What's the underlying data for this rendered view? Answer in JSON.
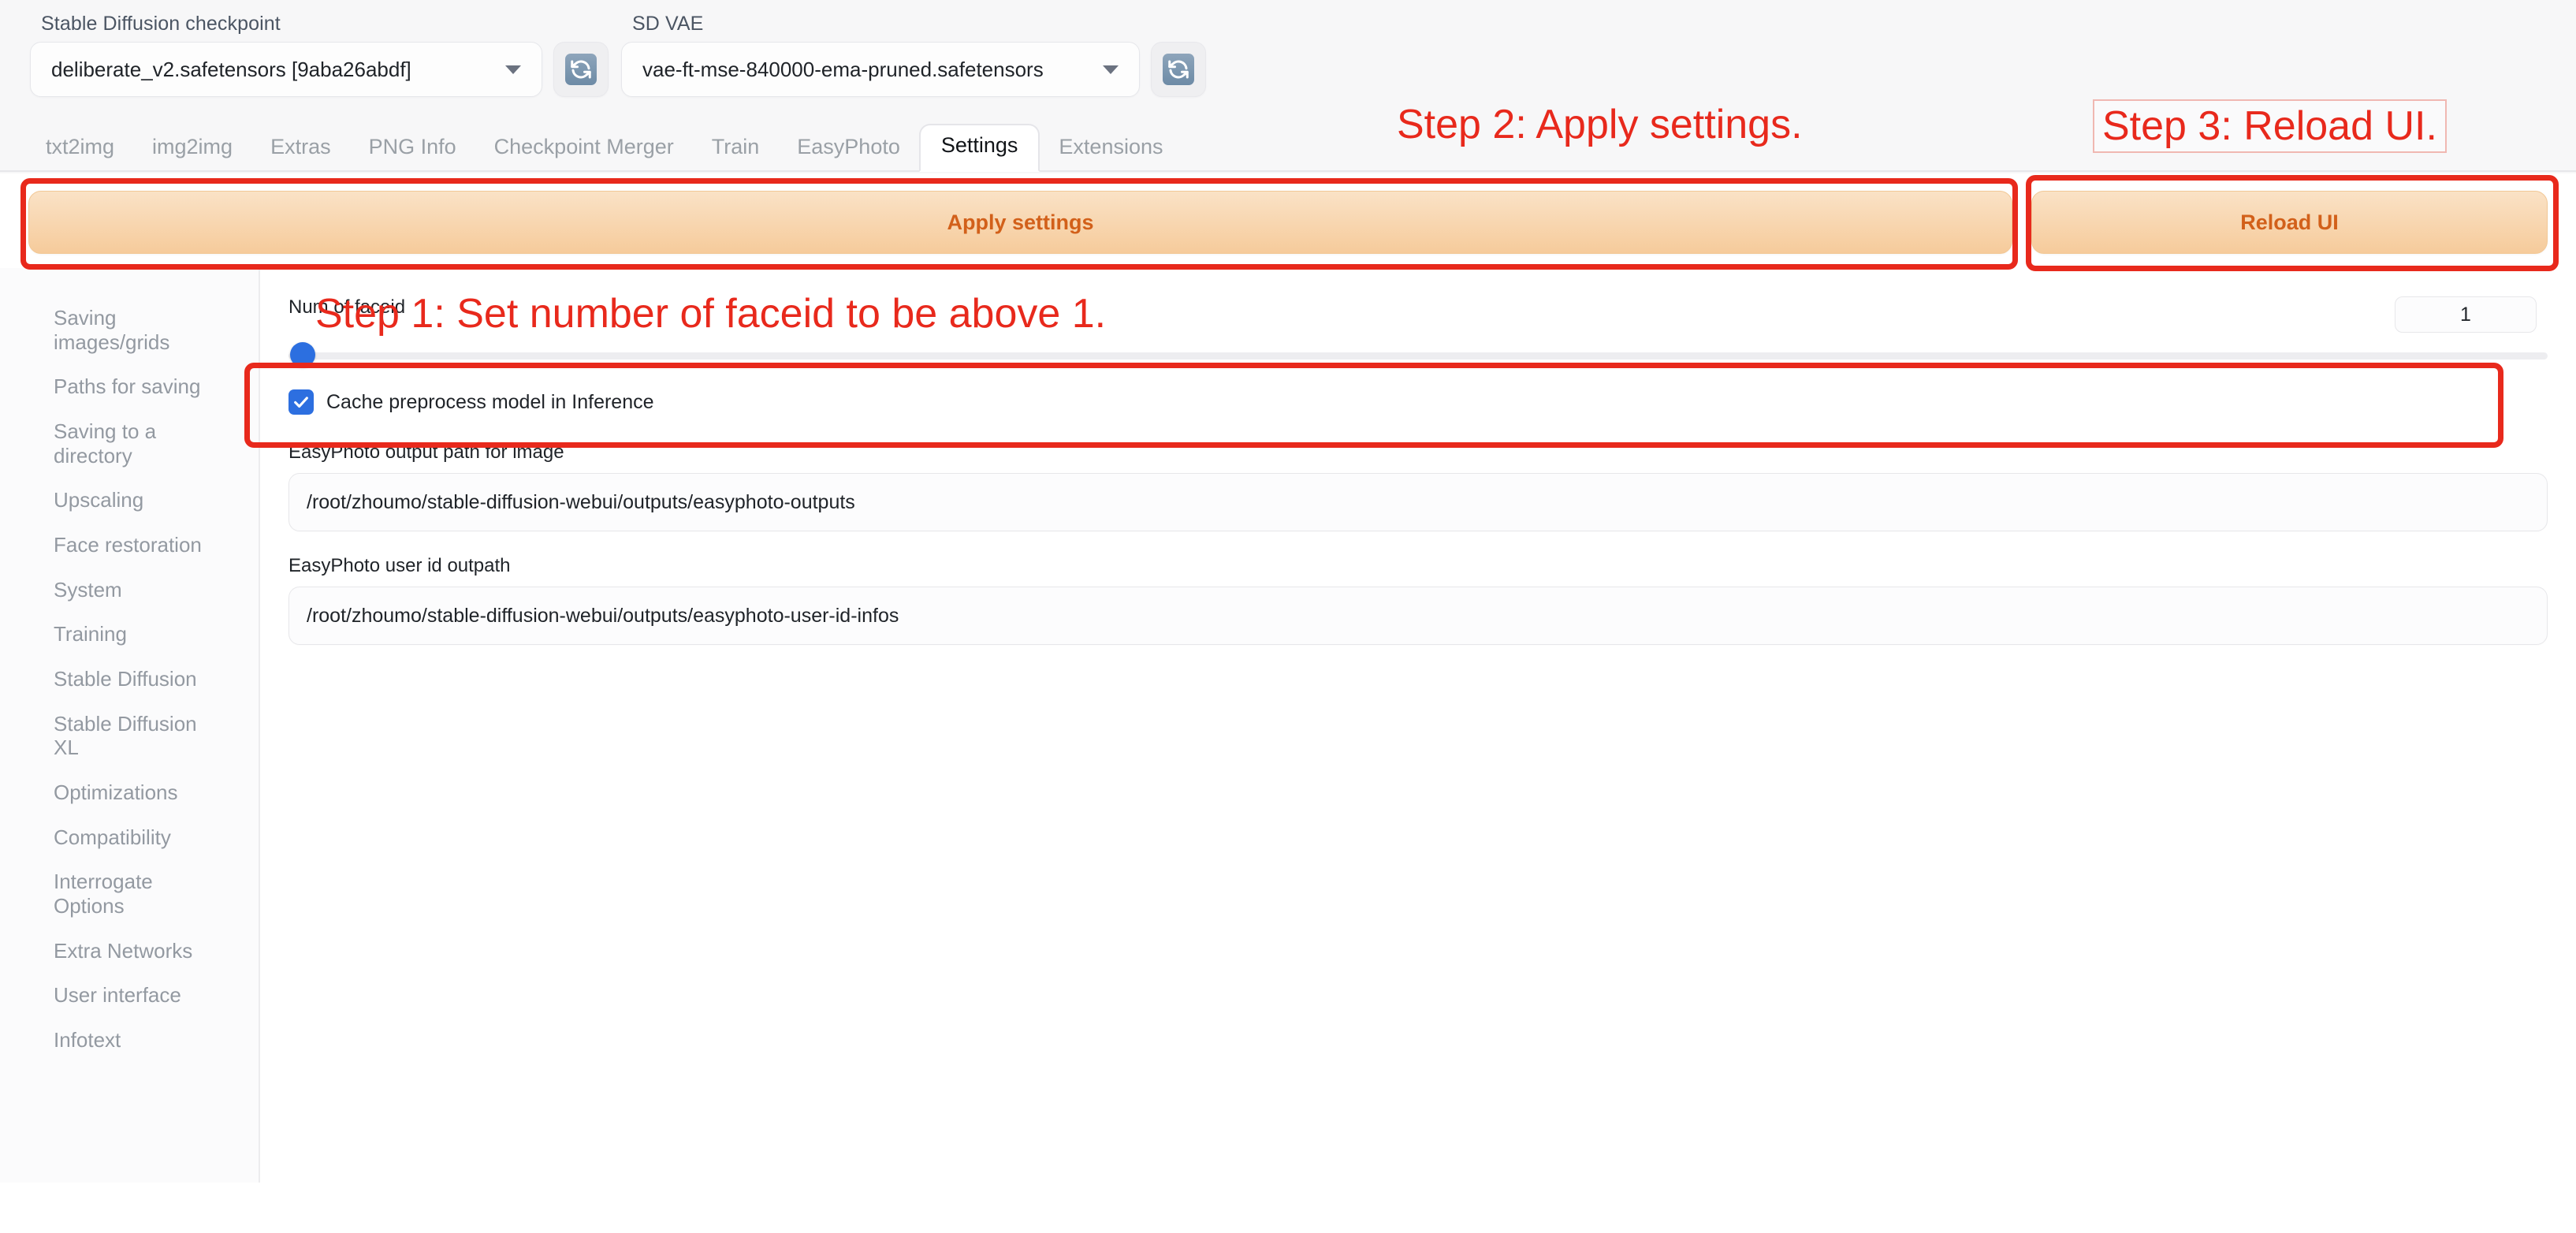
{
  "quick_settings": {
    "checkpoint": {
      "label": "Stable Diffusion checkpoint",
      "value": "deliberate_v2.safetensors [9aba26abdf]",
      "refresh_icon": "refresh-icon"
    },
    "vae": {
      "label": "SD VAE",
      "value": "vae-ft-mse-840000-ema-pruned.safetensors",
      "refresh_icon": "refresh-icon"
    }
  },
  "tabs": [
    {
      "label": "txt2img",
      "selected": false
    },
    {
      "label": "img2img",
      "selected": false
    },
    {
      "label": "Extras",
      "selected": false
    },
    {
      "label": "PNG Info",
      "selected": false
    },
    {
      "label": "Checkpoint Merger",
      "selected": false
    },
    {
      "label": "Train",
      "selected": false
    },
    {
      "label": "EasyPhoto",
      "selected": false
    },
    {
      "label": "Settings",
      "selected": true
    },
    {
      "label": "Extensions",
      "selected": false
    }
  ],
  "toolbar": {
    "apply_settings_label": "Apply settings",
    "reload_ui_label": "Reload UI"
  },
  "sidebar": {
    "items": [
      {
        "label": "Saving images/grids"
      },
      {
        "label": "Paths for saving"
      },
      {
        "label": "Saving to a directory"
      },
      {
        "label": "Upscaling"
      },
      {
        "label": "Face restoration"
      },
      {
        "label": "System"
      },
      {
        "label": "Training"
      },
      {
        "label": "Stable Diffusion"
      },
      {
        "label": "Stable Diffusion XL"
      },
      {
        "label": "Optimizations"
      },
      {
        "label": "Compatibility"
      },
      {
        "label": "Interrogate Options"
      },
      {
        "label": "Extra Networks"
      },
      {
        "label": "User interface"
      },
      {
        "label": "Infotext"
      }
    ]
  },
  "settings_panel": {
    "num_of_faceid": {
      "label": "Num of faceid",
      "value": "1",
      "slider_percent": 0
    },
    "cache_preprocess": {
      "label": "Cache preprocess model in Inference",
      "checked": true,
      "check_icon": "check-icon"
    },
    "output_path": {
      "label": "EasyPhoto output path for image",
      "value": "/root/zhoumo/stable-diffusion-webui/outputs/easyphoto-outputs"
    },
    "user_id_outpath": {
      "label": "EasyPhoto user id outpath",
      "value": "/root/zhoumo/stable-diffusion-webui/outputs/easyphoto-user-id-infos"
    }
  },
  "annotations": {
    "step1": "Step 1: Set number of faceid to be above 1.",
    "step2": "Step 2: Apply settings.",
    "step3": "Step 3: Reload UI.",
    "color": "#e8291c"
  }
}
